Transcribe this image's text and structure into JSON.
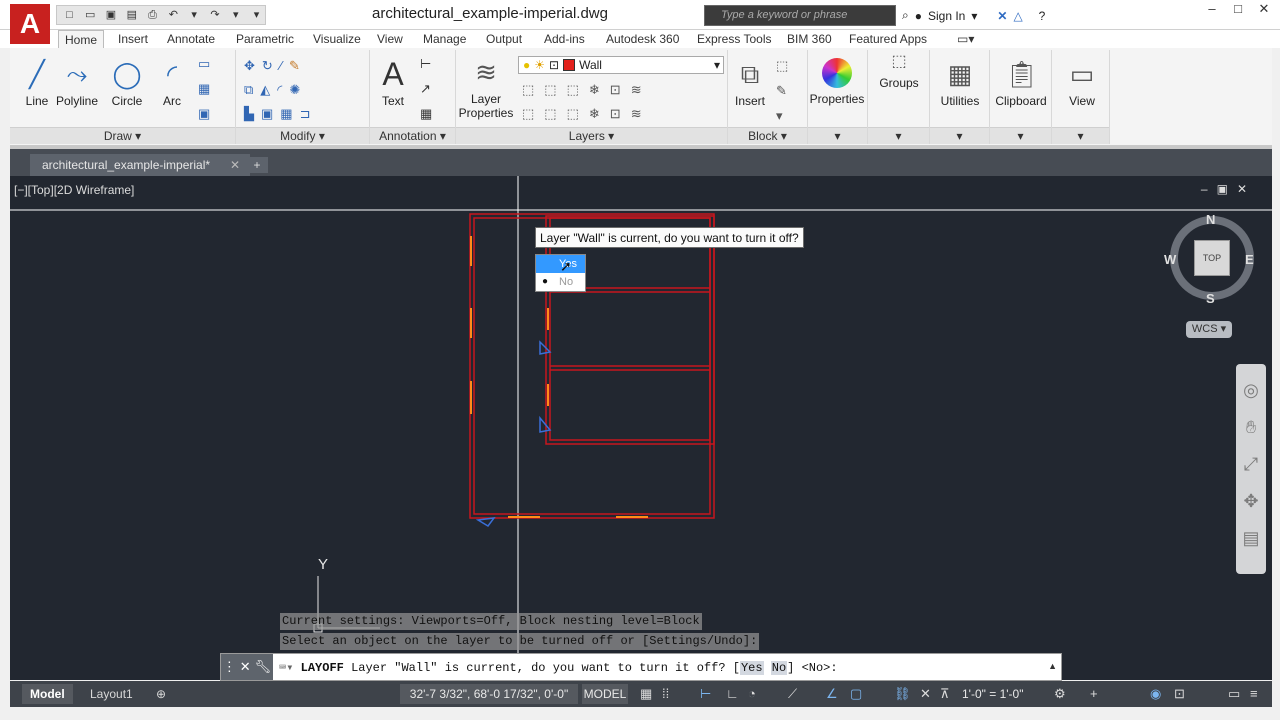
{
  "titlebar": {
    "doc_title": "architectural_example-imperial.dwg",
    "search_placeholder": "Type a keyword or phrase",
    "sign_in": "Sign In"
  },
  "ribbon_tabs": [
    "Home",
    "Insert",
    "Annotate",
    "Parametric",
    "Visualize",
    "View",
    "Manage",
    "Output",
    "Add-ins",
    "Autodesk 360",
    "Express Tools",
    "BIM 360",
    "Featured Apps"
  ],
  "ribbon": {
    "draw": {
      "title": "Draw",
      "line": "Line",
      "polyline": "Polyline",
      "circle": "Circle",
      "arc": "Arc"
    },
    "modify": {
      "title": "Modify"
    },
    "annotation": {
      "title": "Annotation",
      "text": "Text"
    },
    "layers": {
      "title": "Layers",
      "layer_properties_1": "Layer",
      "layer_properties_2": "Properties",
      "current_layer": "Wall",
      "layer_color": "#e3211c"
    },
    "block": {
      "title": "Block",
      "insert": "Insert"
    },
    "properties": "Properties",
    "groups": "Groups",
    "utilities": "Utilities",
    "clipboard": "Clipboard",
    "view": "View"
  },
  "file_tab": {
    "name": "architectural_example-imperial*",
    "new_tab": "+"
  },
  "drawing": {
    "viewport_label": "[−][Top][2D Wireframe]",
    "tooltip": "Layer \"Wall\" is current, do you want to turn it off?",
    "menu": {
      "yes": "Yes",
      "no": "No"
    },
    "viewcube": {
      "n": "N",
      "s": "S",
      "e": "E",
      "w": "W",
      "top": "TOP",
      "wcs": "WCS"
    },
    "ucs_y": "Y",
    "wall_color": "#c8161d",
    "door_color": "#ff8c1a",
    "window_color": "#3a6fd8"
  },
  "command": {
    "history": [
      "Current settings: Viewports=Off, Block nesting level=Block",
      "Select an object on the layer to be turned off or [Settings/Undo]:"
    ],
    "cmd_name": "LAYOFF",
    "prompt_before": " Layer \"Wall\" is current, do you want to turn it off? [",
    "opt_yes": "Yes",
    "opt_no": "No",
    "prompt_after": "] <No>:"
  },
  "statusbar": {
    "tab_model": "Model",
    "tab_layout1": "Layout1",
    "coords": "32'-7 3/32\", 68'-0 17/32\", 0'-0\"",
    "model_space": "MODEL",
    "scale": "1'-0\" = 1'-0\""
  }
}
